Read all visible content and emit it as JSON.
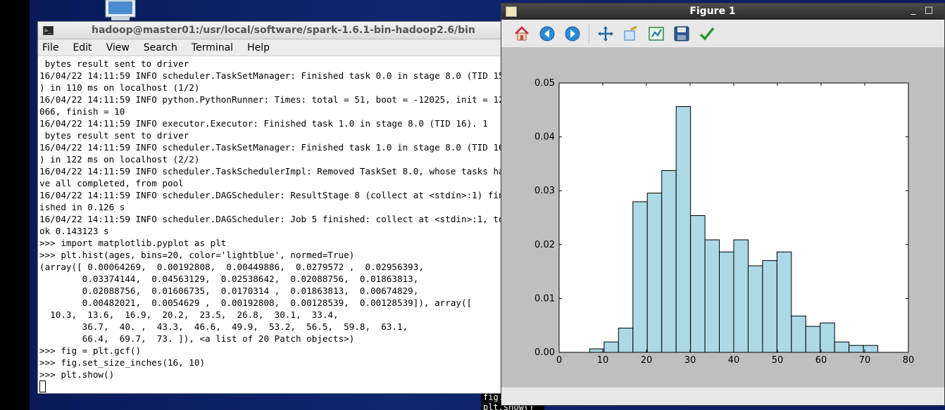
{
  "terminal": {
    "title": "hadoop@master01:/usr/local/software/spark-1.6.1-bin-hadoop2.6/bin",
    "menu": [
      "File",
      "Edit",
      "View",
      "Search",
      "Terminal",
      "Help"
    ],
    "lines": [
      " bytes result sent to driver",
      "16/04/22 14:11:59 INFO scheduler.TaskSetManager: Finished task 0.0 in stage 8.0 (TID 15",
      ") in 110 ms on localhost (1/2)",
      "16/04/22 14:11:59 INFO python.PythonRunner: Times: total = 51, boot = -12025, init = 12",
      "066, finish = 10",
      "16/04/22 14:11:59 INFO executor.Executor: Finished task 1.0 in stage 8.0 (TID 16). 1",
      " bytes result sent to driver",
      "16/04/22 14:11:59 INFO scheduler.TaskSetManager: Finished task 1.0 in stage 8.0 (TID 16",
      ") in 122 ms on localhost (2/2)",
      "16/04/22 14:11:59 INFO scheduler.TaskSchedulerImpl: Removed TaskSet 8.0, whose tasks ha",
      "ve all completed, from pool",
      "16/04/22 14:11:59 INFO scheduler.DAGScheduler: ResultStage 8 (collect at <stdin>:1) fin",
      "ished in 0.126 s",
      "16/04/22 14:11:59 INFO scheduler.DAGScheduler: Job 5 finished: collect at <stdin>:1, to",
      "ok 0.143123 s",
      ">>> import matplotlib.pyplot as plt",
      ">>> plt.hist(ages, bins=20, color='lightblue', normed=True)",
      "(array([ 0.00064269,  0.00192808,  0.00449886,  0.0279572 ,  0.02956393,",
      "        0.03374144,  0.04563129,  0.02538642,  0.02088756,  0.01863813,",
      "        0.02088756,  0.01606735,  0.0170314 ,  0.01863813,  0.00674829,",
      "        0.00482021,  0.0054629 ,  0.00192808,  0.00128539,  0.00128539]), array([",
      "  10.3,  13.6,  16.9,  20.2,  23.5,  26.8,  30.1,  33.4,",
      "        36.7,  40. ,  43.3,  46.6,  49.9,  53.2,  56.5,  59.8,  63.1,",
      "        66.4,  69.7,  73. ]), <a list of 20 Patch objects>)",
      ">>> fig = plt.gcf()",
      ">>> fig.set_size_inches(16, 10)",
      ">>> plt.show()"
    ]
  },
  "background_terminal": {
    "lines": [
      "fig.set_",
      "plt.show()"
    ]
  },
  "figure": {
    "title": "Figure 1",
    "minimize_glyph": "_",
    "maximize_glyph": "□",
    "toolbar_icons": [
      "home-icon",
      "back-icon",
      "forward-icon",
      "pan-icon",
      "zoom-icon",
      "configure-subplots-icon",
      "save-icon",
      "edit-check-icon"
    ]
  },
  "chart_data": {
    "type": "bar",
    "title": "",
    "xlabel": "",
    "ylabel": "",
    "xlim": [
      0,
      80
    ],
    "ylim": [
      0,
      0.05
    ],
    "xticks": [
      0,
      10,
      20,
      30,
      40,
      50,
      60,
      70,
      80
    ],
    "yticks": [
      0.0,
      0.01,
      0.02,
      0.03,
      0.04,
      0.05
    ],
    "ytick_labels": [
      "0.00",
      "0.01",
      "0.02",
      "0.03",
      "0.04",
      "0.05"
    ],
    "bin_edges": [
      7.0,
      10.3,
      13.6,
      16.9,
      20.2,
      23.5,
      26.8,
      30.1,
      33.4,
      36.7,
      40.0,
      43.3,
      46.6,
      49.9,
      53.2,
      56.5,
      59.8,
      63.1,
      66.4,
      69.7,
      73.0
    ],
    "values": [
      0.00064269,
      0.00192808,
      0.00449886,
      0.0279572,
      0.02956393,
      0.03374144,
      0.04563129,
      0.02538642,
      0.02088756,
      0.01863813,
      0.02088756,
      0.01606735,
      0.0170314,
      0.01863813,
      0.00674829,
      0.00482021,
      0.0054629,
      0.00192808,
      0.00128539,
      0.00128539
    ],
    "bar_color": "#add8e6",
    "edge_color": "#000000",
    "grid": false
  }
}
